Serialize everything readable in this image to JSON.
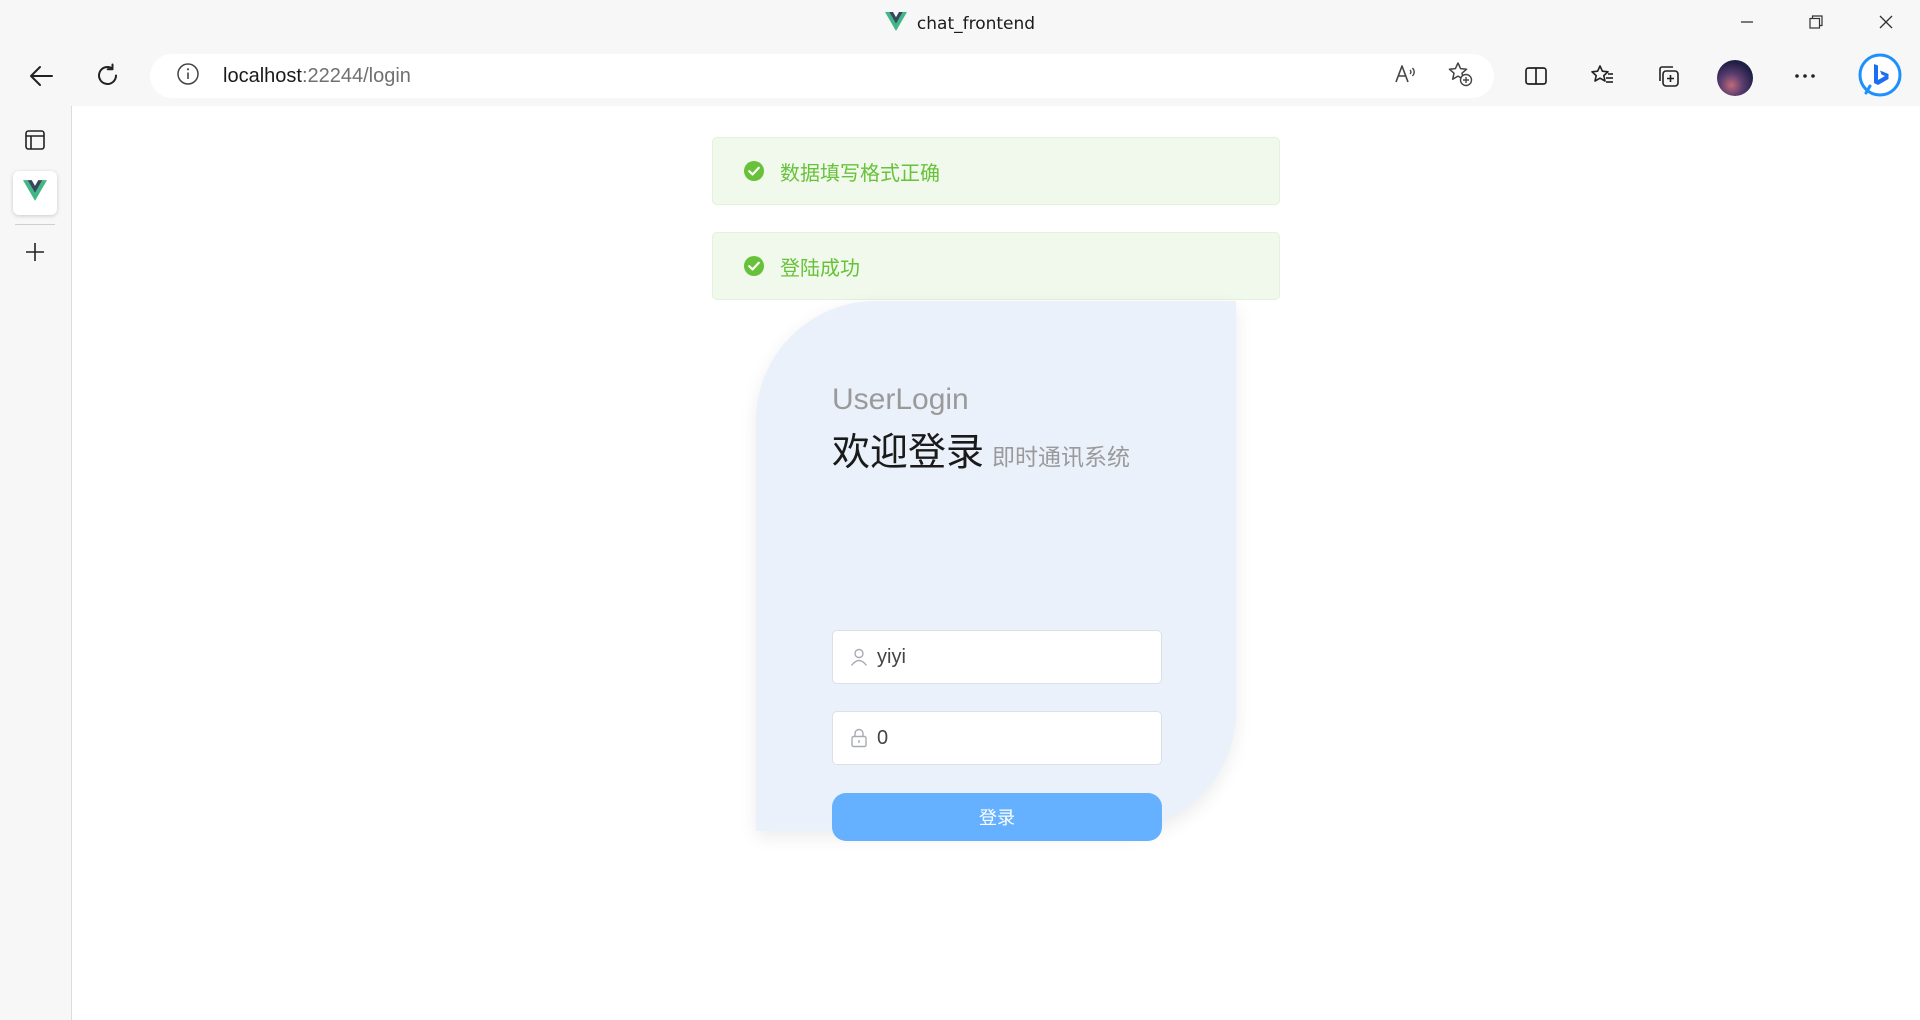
{
  "window": {
    "title": "chat_frontend",
    "tab_icon": "vue-logo-icon",
    "controls": [
      "minimize-icon",
      "restore-icon",
      "close-icon"
    ]
  },
  "toolbar": {
    "url_host": "localhost",
    "url_rest": ":22244/login",
    "buttons": [
      "back-icon",
      "refresh-icon",
      "site-info-icon",
      "read-aloud-icon",
      "add-favorite-icon",
      "split-screen-icon",
      "favorites-icon",
      "collections-icon",
      "profile-avatar",
      "more-icon",
      "bing-copilot-icon"
    ]
  },
  "sidebar": {
    "items": [
      "tab-actions-icon",
      "vue-tab-icon",
      "new-tab-icon"
    ]
  },
  "messages": [
    {
      "text": "数据填写格式正确",
      "type": "success"
    },
    {
      "text": "登陆成功",
      "type": "success"
    }
  ],
  "login": {
    "subtitle": "UserLogin",
    "title": "欢迎登录",
    "title_small": "即时通讯系统",
    "username_value": "yiyi",
    "password_value": "0",
    "button_label": "登录"
  },
  "colors": {
    "success": "#67c23a",
    "success_bg": "#f0f9eb",
    "card_bg": "#eaf1fb",
    "button": "#66b1ff"
  }
}
